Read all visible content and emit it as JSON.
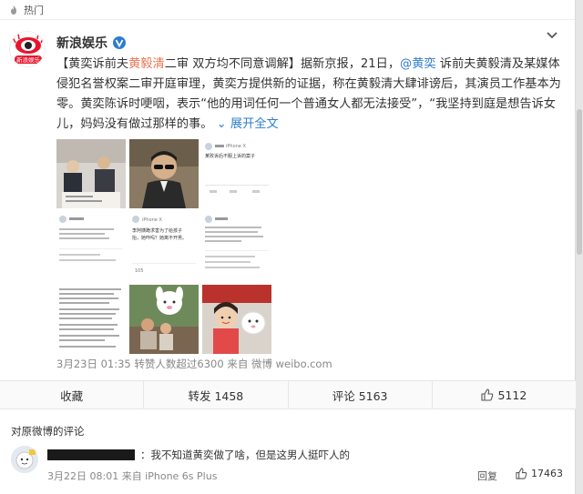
{
  "hot_bar": {
    "label": "热门"
  },
  "post": {
    "author": "新浪娱乐",
    "verified_icon": "verified-v-icon",
    "avatar_text": "新浪娱乐",
    "text_segments": {
      "s1": "【黄奕诉前夫",
      "s2": "黄毅清",
      "s3": "二审 双方均不同意调解】据新京报，21日，",
      "s4": "@黄奕",
      "s5": " 诉前夫黄毅清及某媒体侵犯名誉权案二审开庭审理，黄奕方提供新的证据，称在黄毅清大肆诽谤后，其演员工作基本为零。黄奕陈诉时哽咽，表示“他的用词任何一个普通女人都无法接受”，“我坚持到庭是想告诉女儿，妈妈没有做过那样的事。",
      "expand": "展开全文",
      "expand_arrow": "⌄"
    },
    "meta": "3月23日 01:35 转赞人数超过6300 来自 微博 weibo.com",
    "images": [
      {
        "name": "photo-courtroom"
      },
      {
        "name": "photo-man-sunglasses"
      },
      {
        "name": "screenshot-iphone-x",
        "lines": [
          "iPhone X",
          "某败诉后不服上诉的案子"
        ]
      },
      {
        "name": "screenshot-post-1"
      },
      {
        "name": "screenshot-comment",
        "lines": [
          "iPhone X",
          "李阿姨跪求害为了给孩子",
          "抬，她咋吗？她离不开男。"
        ],
        "count": "105"
      },
      {
        "name": "screenshot-post-2"
      },
      {
        "name": "screenshot-document-1"
      },
      {
        "name": "photo-family-cartoon"
      },
      {
        "name": "photo-child-cartoon"
      }
    ]
  },
  "actions": {
    "favorite": "收藏",
    "repost": "转发 1458",
    "comment": "评论 5163",
    "like": "5112"
  },
  "comment_section": {
    "heading": "对原微博的评论",
    "comment": {
      "text": "：我不知道黄奕做了啥，但是这男人挺吓人的",
      "meta": "3月22日 08:01 来自 iPhone 6s Plus",
      "reply": "回复",
      "likes": "17463"
    }
  },
  "colors": {
    "highlight": "#eb7350",
    "link": "#2f7cce"
  }
}
